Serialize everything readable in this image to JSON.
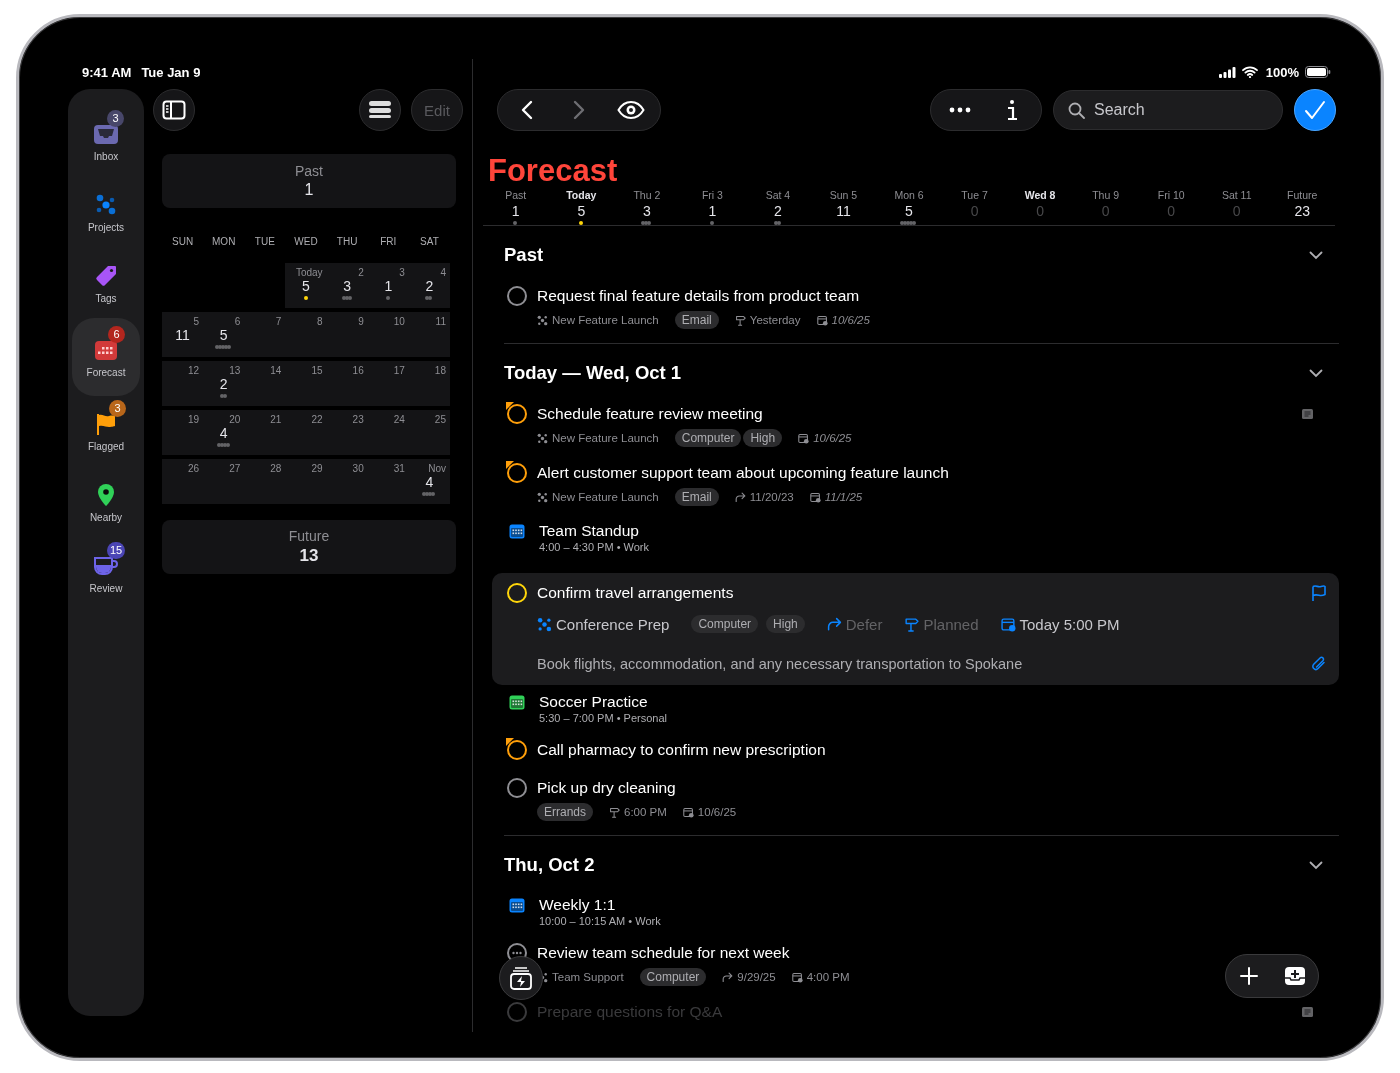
{
  "status_bar": {
    "time": "9:41 AM",
    "date": "Tue Jan 9",
    "battery": "100%"
  },
  "sidebar": {
    "items": [
      {
        "label": "Inbox",
        "kind": "inbox",
        "badge": "3",
        "selected": false
      },
      {
        "label": "Projects",
        "kind": "projects",
        "selected": false
      },
      {
        "label": "Tags",
        "kind": "tags",
        "selected": false
      },
      {
        "label": "Forecast",
        "kind": "forecast",
        "badge": "6",
        "selected": true
      },
      {
        "label": "Flagged",
        "kind": "flagged",
        "badge": "3",
        "selected": false
      },
      {
        "label": "Nearby",
        "kind": "nearby",
        "selected": false
      },
      {
        "label": "Review",
        "kind": "review",
        "badge": "15",
        "selected": false
      }
    ]
  },
  "calendar": {
    "edit_button": {
      "label": "Edit",
      "disabled": true
    },
    "past": {
      "label": "Past",
      "count": "1"
    },
    "weekdays": [
      "SUN",
      "MON",
      "TUE",
      "WED",
      "THU",
      "FRI",
      "SAT"
    ],
    "weeks": [
      {
        "cells": [
          {
            "day": "Today",
            "count": "5",
            "today": true
          },
          {
            "day": "2",
            "count": "3"
          },
          {
            "day": "3",
            "count": "1"
          },
          {
            "day": "4",
            "count": "2"
          }
        ]
      },
      {
        "cells": [
          {
            "day": "5",
            "count": "11"
          },
          {
            "day": "6",
            "count": "5"
          },
          {
            "day": "7"
          },
          {
            "day": "8"
          },
          {
            "day": "9"
          },
          {
            "day": "10"
          },
          {
            "day": "11"
          }
        ]
      },
      {
        "cells": [
          {
            "day": "12"
          },
          {
            "day": "13",
            "count": "2"
          },
          {
            "day": "14"
          },
          {
            "day": "15"
          },
          {
            "day": "16"
          },
          {
            "day": "17"
          },
          {
            "day": "18"
          }
        ]
      },
      {
        "cells": [
          {
            "day": "19"
          },
          {
            "day": "20",
            "count": "4"
          },
          {
            "day": "21"
          },
          {
            "day": "22"
          },
          {
            "day": "23"
          },
          {
            "day": "24"
          },
          {
            "day": "25"
          }
        ]
      },
      {
        "cells": [
          {
            "day": "26"
          },
          {
            "day": "27"
          },
          {
            "day": "28"
          },
          {
            "day": "29"
          },
          {
            "day": "30"
          },
          {
            "day": "31"
          },
          {
            "day": "Nov",
            "count": "4"
          }
        ]
      }
    ],
    "future": {
      "label": "Future",
      "count": "13"
    }
  },
  "main": {
    "search": {
      "placeholder": "Search"
    },
    "title": "Forecast",
    "strip": [
      {
        "label": "Past",
        "count": "1",
        "emphasized": false,
        "today": false,
        "empty": false
      },
      {
        "label": "Today",
        "count": "5",
        "emphasized": true,
        "today": true,
        "empty": false
      },
      {
        "label": "Thu 2",
        "count": "3",
        "emphasized": false,
        "today": false,
        "empty": false
      },
      {
        "label": "Fri 3",
        "count": "1",
        "emphasized": false,
        "today": false,
        "empty": false
      },
      {
        "label": "Sat 4",
        "count": "2",
        "emphasized": false,
        "today": false,
        "empty": false
      },
      {
        "label": "Sun 5",
        "count": "11",
        "emphasized": false,
        "today": false,
        "empty": false
      },
      {
        "label": "Mon 6",
        "count": "5",
        "emphasized": false,
        "today": false,
        "empty": false
      },
      {
        "label": "Tue 7",
        "count": "0",
        "emphasized": false,
        "today": false,
        "empty": true
      },
      {
        "label": "Wed 8",
        "count": "0",
        "emphasized": true,
        "today": false,
        "empty": true
      },
      {
        "label": "Thu 9",
        "count": "0",
        "emphasized": false,
        "today": false,
        "empty": true
      },
      {
        "label": "Fri 10",
        "count": "0",
        "emphasized": false,
        "today": false,
        "empty": true
      },
      {
        "label": "Sat 11",
        "count": "0",
        "emphasized": false,
        "today": false,
        "empty": true
      },
      {
        "label": "Future",
        "count": "23",
        "emphasized": false,
        "today": false,
        "empty": false
      }
    ],
    "sections": [
      {
        "title": "Past",
        "expanded": true,
        "items": [
          {
            "kind": "task",
            "flagged": false,
            "due_soon": false,
            "waiting": false,
            "title": "Request final feature details from product team",
            "selected": false,
            "faded": false,
            "has_note": false,
            "meta": [
              {
                "kind": "project",
                "text": "New Feature Launch"
              },
              {
                "kind": "tag",
                "text": "Email"
              },
              {
                "kind": "planned",
                "text": "Yesterday",
                "italic": false
              },
              {
                "kind": "due",
                "text": "10/6/25",
                "italic": true
              }
            ]
          }
        ]
      },
      {
        "title": "Today — Wed, Oct 1",
        "expanded": true,
        "items": [
          {
            "kind": "task",
            "flagged": true,
            "due_soon": false,
            "waiting": false,
            "title": "Schedule feature review meeting",
            "selected": false,
            "faded": false,
            "has_note": true,
            "meta": [
              {
                "kind": "project",
                "text": "New Feature Launch"
              },
              {
                "kind": "tag",
                "text": "Computer"
              },
              {
                "kind": "tag",
                "text": "High"
              },
              {
                "kind": "due",
                "text": "10/6/25",
                "italic": true
              }
            ]
          },
          {
            "kind": "task",
            "flagged": true,
            "due_soon": false,
            "waiting": false,
            "title": "Alert customer support team about upcoming feature launch",
            "selected": false,
            "faded": false,
            "has_note": false,
            "meta": [
              {
                "kind": "project",
                "text": "New Feature Launch"
              },
              {
                "kind": "tag",
                "text": "Email"
              },
              {
                "kind": "defer",
                "text": "11/20/23",
                "italic": false
              },
              {
                "kind": "due",
                "text": "11/1/25",
                "italic": true
              }
            ]
          },
          {
            "kind": "event",
            "title": "Team Standup",
            "subtitle": "4:00 – 4:30 PM • Work",
            "color": "#0a84ff"
          },
          {
            "kind": "task",
            "flagged": false,
            "due_soon": true,
            "waiting": false,
            "title": "Confirm travel arrangements",
            "selected": true,
            "faded": false,
            "has_note": false,
            "note": "Book flights, accommodation, and any necessary transportation to Spokane",
            "meta": [
              {
                "kind": "project",
                "text": "Conference Prep"
              },
              {
                "kind": "tag",
                "text": "Computer"
              },
              {
                "kind": "tag",
                "text": "High"
              },
              {
                "kind": "defer",
                "text": "Defer",
                "placeholder": true
              },
              {
                "kind": "planned",
                "text": "Planned",
                "placeholder": true
              },
              {
                "kind": "due",
                "text": "Today 5:00 PM",
                "placeholder": false
              }
            ]
          },
          {
            "kind": "event",
            "title": "Soccer Practice",
            "subtitle": "5:30 – 7:00 PM • Personal",
            "color": "#30d158"
          },
          {
            "kind": "task",
            "flagged": true,
            "due_soon": false,
            "waiting": false,
            "title": "Call pharmacy to confirm new prescription",
            "selected": false,
            "faded": false,
            "has_note": false
          },
          {
            "kind": "task",
            "flagged": false,
            "due_soon": false,
            "waiting": false,
            "title": "Pick up dry cleaning",
            "selected": false,
            "faded": false,
            "has_note": false,
            "meta": [
              {
                "kind": "tag",
                "text": "Errands"
              },
              {
                "kind": "planned",
                "text": "6:00 PM",
                "italic": false
              },
              {
                "kind": "due",
                "text": "10/6/25",
                "italic": false
              }
            ]
          }
        ]
      },
      {
        "title": "Thu, Oct 2",
        "expanded": true,
        "items": [
          {
            "kind": "event",
            "title": "Weekly 1:1",
            "subtitle": "10:00 – 10:15 AM • Work",
            "color": "#0a84ff"
          },
          {
            "kind": "task",
            "flagged": false,
            "due_soon": false,
            "waiting": true,
            "title": "Review team schedule for next week",
            "selected": false,
            "faded": false,
            "has_note": false,
            "meta": [
              {
                "kind": "project",
                "text": "Team Support"
              },
              {
                "kind": "tag",
                "text": "Computer"
              },
              {
                "kind": "defer",
                "text": "9/29/25",
                "italic": false
              },
              {
                "kind": "due",
                "text": "4:00 PM",
                "italic": false
              }
            ]
          },
          {
            "kind": "task",
            "flagged": false,
            "due_soon": false,
            "waiting": false,
            "title": "Prepare questions for Q&A",
            "selected": false,
            "faded": true,
            "has_note": true
          }
        ]
      }
    ]
  }
}
